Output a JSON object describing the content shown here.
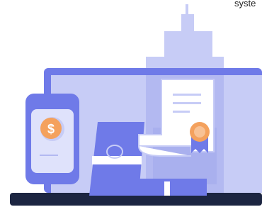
{
  "header": {
    "cropped_text": "syste"
  },
  "illustration": {
    "icons": [
      "building-icon",
      "laptop-icon",
      "smartphone-icon",
      "dollar-coin-icon",
      "cash-stack-icon",
      "certificate-icon",
      "award-badge-icon"
    ],
    "colors": {
      "primary": "#6f7ae8",
      "light": "#c7ccf6",
      "pale": "#dfe2fb",
      "dark": "#1c2541",
      "coin": "#f4a15d",
      "white": "#ffffff"
    }
  }
}
